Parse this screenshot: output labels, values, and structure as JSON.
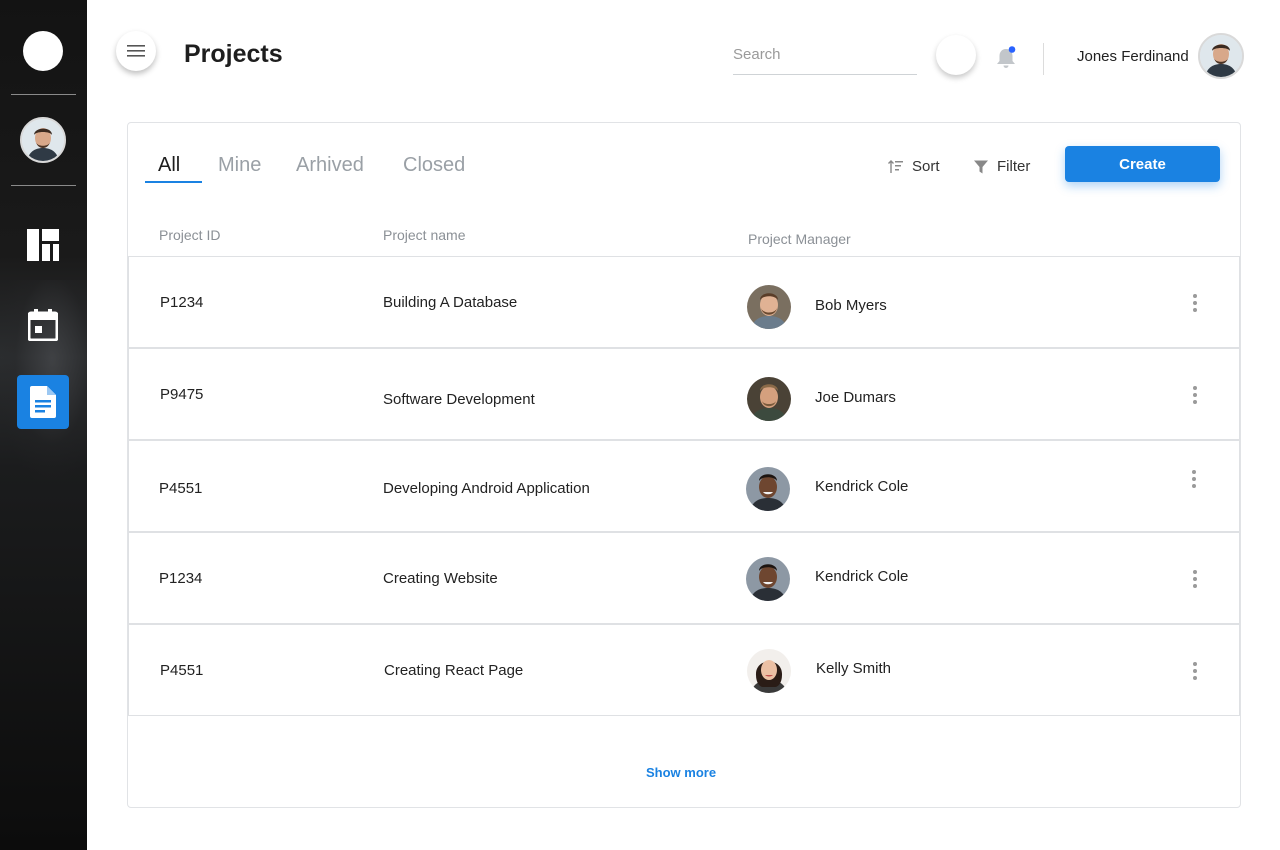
{
  "header": {
    "title": "Projects",
    "search_placeholder": "Search",
    "user_name": "Jones Ferdinand",
    "notification_dot_color": "#2962ff"
  },
  "sidebar": {
    "icons": [
      "dashboard-icon",
      "calendar-icon",
      "document-icon"
    ],
    "active": "document-icon",
    "accent": "#1a82e2"
  },
  "tabs": [
    {
      "label": "All",
      "active": true
    },
    {
      "label": "Mine",
      "active": false
    },
    {
      "label": "Arhived",
      "active": false
    },
    {
      "label": "Closed",
      "active": false
    }
  ],
  "toolbar": {
    "sort_label": "Sort",
    "filter_label": "Filter",
    "create_label": "Create"
  },
  "table": {
    "columns": [
      "Project ID",
      "Project name",
      "Project Manager"
    ],
    "rows": [
      {
        "id": "P1234",
        "name": "Building A Database",
        "manager": "Bob Myers"
      },
      {
        "id": "P9475",
        "name": "Software Development",
        "manager": "Joe Dumars"
      },
      {
        "id": "P4551",
        "name": "Developing Android Application",
        "manager": "Kendrick Cole"
      },
      {
        "id": "P1234",
        "name": "Creating Website",
        "manager": "Kendrick Cole"
      },
      {
        "id": "P4551",
        "name": "Creating React Page",
        "manager": "Kelly Smith"
      }
    ]
  },
  "footer": {
    "show_more_label": "Show more"
  }
}
